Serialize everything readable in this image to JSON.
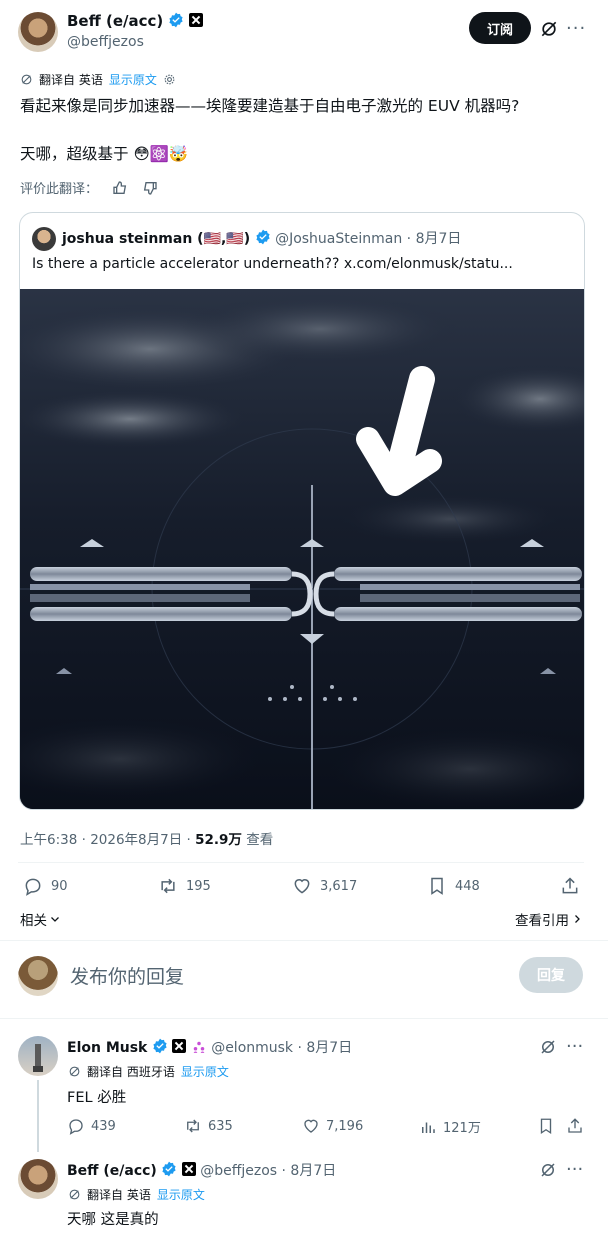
{
  "main_post": {
    "author_name": "Beff (e/acc)",
    "handle": "@beffjezos",
    "subscribe_label": "订阅",
    "translated_from": "翻译自 英语",
    "show_original": "显示原文",
    "text_line1": "看起来像是同步加速器——埃隆要建造基于自由电子激光的 EUV 机器吗?",
    "text_line2": "天哪，超级基于",
    "emojis": "😳⚛️🤯",
    "rate_translation": "评价此翻译：",
    "timestamp": "上午6:38 · 2026年8月7日 · ",
    "views_count": "52.9万",
    "views_label": " 查看"
  },
  "quote": {
    "author_name": "joshua steinman (🇺🇸,🇺🇸)",
    "handle": "@JoshuaSteinman",
    "date": "· 8月7日",
    "text": "Is there a particle accelerator underneath??  x.com/elonmusk/statu..."
  },
  "actions": {
    "replies": "90",
    "reposts": "195",
    "likes": "3,617",
    "bookmarks": "448"
  },
  "related": {
    "label": "相关",
    "view_quotes": "查看引用"
  },
  "reply_box": {
    "placeholder": "发布你的回复",
    "button": "回复"
  },
  "replies": [
    {
      "author_name": "Elon Musk",
      "handle": "@elonmusk",
      "date": "· 8月7日",
      "translated_from": "翻译自 西班牙语",
      "show_original": "显示原文",
      "text": "FEL 必胜",
      "reply_count": "439",
      "repost_count": "635",
      "like_count": "7,196",
      "view_count": "121万"
    },
    {
      "author_name": "Beff (e/acc)",
      "handle": "@beffjezos",
      "date": "· 8月7日",
      "translated_from": "翻译自 英语",
      "show_original": "显示原文",
      "text": "天哪 这是真的"
    }
  ],
  "colors": {
    "accent": "#1d9bf0",
    "text": "#0f1419",
    "muted": "#536471",
    "subscribe_bg": "#0f1419",
    "reply_button_bg": "#8ecdf8"
  }
}
